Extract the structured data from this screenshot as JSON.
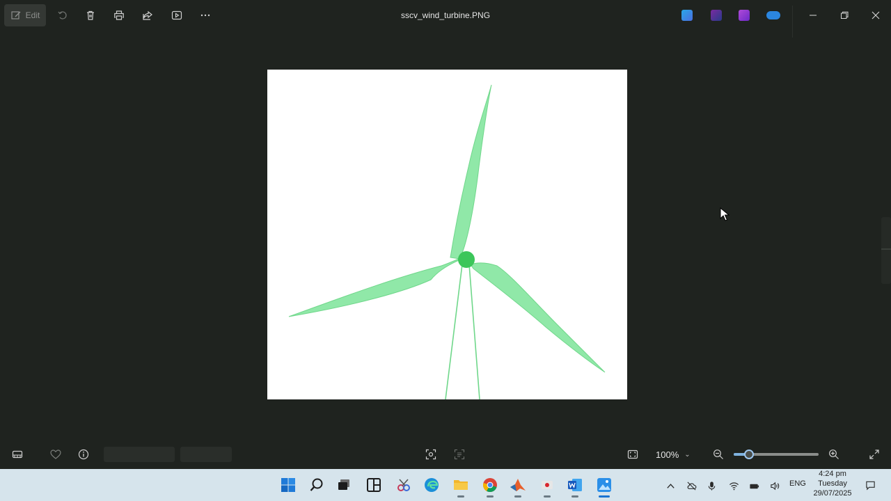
{
  "window": {
    "title": "sscv_wind_turbine.PNG"
  },
  "toolbar": {
    "edit_label": "Edit",
    "icons": [
      "edit-icon",
      "rotate-icon",
      "delete-icon",
      "print-icon",
      "share-icon",
      "slideshow-icon",
      "more-icon"
    ]
  },
  "titlebar_apps": [
    "designer-icon",
    "clipchamp-icon",
    "video-editor-icon",
    "onedrive-icon"
  ],
  "window_controls": [
    "minimize",
    "maximize",
    "close"
  ],
  "image": {
    "alt": "wind turbine",
    "blade_color": "#90e8a8",
    "hub_color": "#3cc65a"
  },
  "bottom": {
    "zoom_value": "100%",
    "zoom_level": 0.18,
    "accent": "#7fb3e0"
  },
  "taskbar": {
    "apps": [
      "start-icon",
      "search-icon",
      "task-view-icon",
      "widgets-icon",
      "snipping-icon",
      "edge-icon",
      "file-explorer-icon",
      "chrome-icon",
      "matlab-icon",
      "recorder-icon",
      "word-icon",
      "photos-icon"
    ],
    "language": "ENG",
    "time": "4:24 pm",
    "weekday": "Tuesday",
    "date": "29/07/2025"
  }
}
